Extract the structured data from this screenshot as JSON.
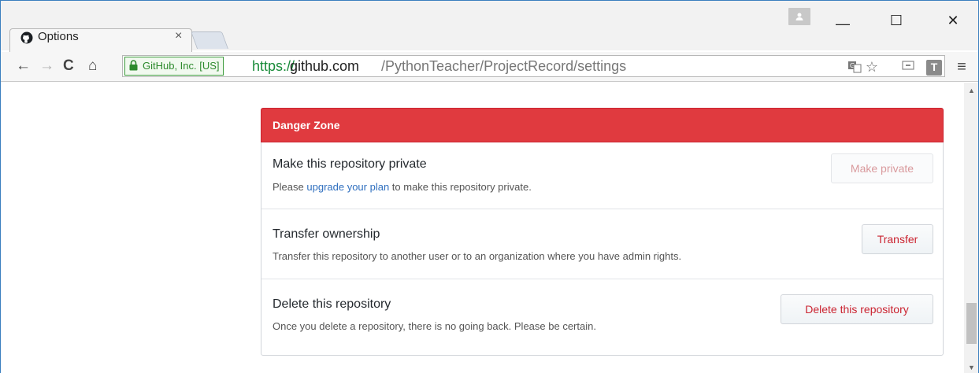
{
  "browser": {
    "tab_title": "Options",
    "tab_close": "×",
    "ev_label": "GitHub, Inc. [US]",
    "url_scheme": "https://",
    "url_host": "github.com",
    "url_path": "/PythonTeacher/ProjectRecord/settings",
    "nav": {
      "back": "←",
      "forward": "→",
      "reload": "C",
      "home": "⌂"
    },
    "window": {
      "minimize": "—",
      "maximize": "☐",
      "close": "✕"
    },
    "toolbar_icons": {
      "star": "☆",
      "extension_t": "T",
      "menu": "≡"
    }
  },
  "danger_zone": {
    "title": "Danger Zone",
    "rows": [
      {
        "title": "Make this repository private",
        "desc_prefix": "Please ",
        "desc_link": "upgrade your plan",
        "desc_suffix": " to make this repository private.",
        "button": "Make private"
      },
      {
        "title": "Transfer ownership",
        "desc": "Transfer this repository to another user or to an organization where you have admin rights.",
        "button": "Transfer"
      },
      {
        "title": "Delete this repository",
        "desc": "Once you delete a repository, there is no going back. Please be certain.",
        "button": "Delete this repository"
      }
    ]
  },
  "colors": {
    "danger_header": "#e03a3f",
    "danger_button_text": "#cb2431",
    "link": "#2f6fbf",
    "ev_green": "#2d8a2d"
  }
}
